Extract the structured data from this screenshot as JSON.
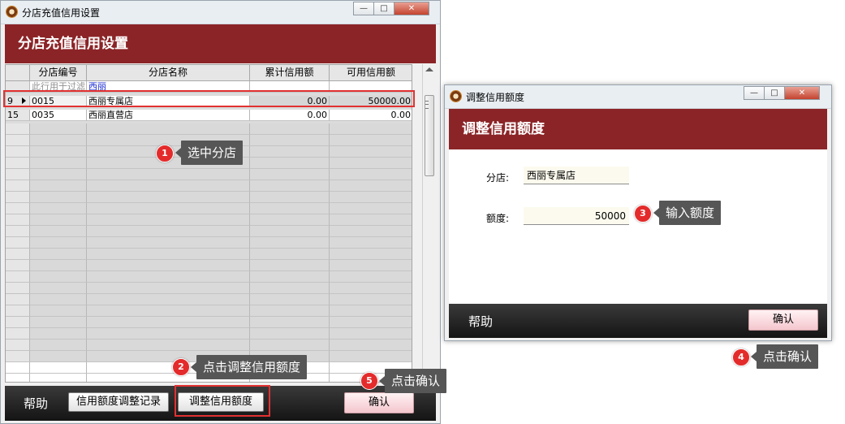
{
  "main_window": {
    "title": "分店充值信用设置",
    "header": "分店充值信用设置",
    "grid": {
      "columns": [
        "分店编号",
        "分店名称",
        "累计信用额",
        "可用信用额"
      ],
      "filter_row": {
        "text": "此行用于过滤",
        "name_filter": "西丽"
      },
      "rows": [
        {
          "rownum": "9",
          "code": "0015",
          "name": "西丽专属店",
          "total": "0.00",
          "available": "50000.00",
          "selected": true
        },
        {
          "rownum": "15",
          "code": "0035",
          "name": "西丽直营店",
          "total": "0.00",
          "available": "0.00",
          "selected": false
        }
      ]
    },
    "footer": {
      "help": "帮助",
      "records_button": "信用额度调整记录",
      "adjust_button": "调整信用额度",
      "confirm_button": "确认"
    }
  },
  "dialog": {
    "title": "调整信用额度",
    "header": "调整信用额度",
    "branch_label": "分店:",
    "branch_value": "西丽专属店",
    "amount_label": "额度:",
    "amount_value": "50000",
    "help": "帮助",
    "confirm_button": "确认"
  },
  "annotations": [
    {
      "n": "1",
      "text": "选中分店"
    },
    {
      "n": "2",
      "text": "点击调整信用额度"
    },
    {
      "n": "3",
      "text": "输入额度"
    },
    {
      "n": "4",
      "text": "点击确认"
    },
    {
      "n": "5",
      "text": "点击确认"
    }
  ],
  "window_buttons": {
    "minimize": "—",
    "maximize": "□",
    "close": "✕"
  },
  "colors": {
    "header_bg": "#8b2427",
    "footer_bg": "#1e1e1e",
    "annotation": "#e42b2b",
    "tooltip": "#565656"
  }
}
